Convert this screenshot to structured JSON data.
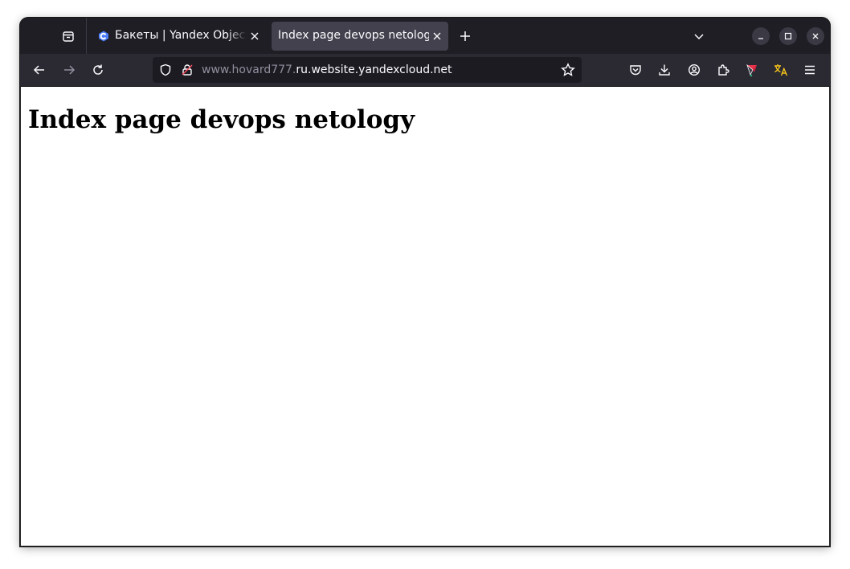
{
  "browser": {
    "tabs": [
      {
        "title": "Бакеты | Yandex Object Storage",
        "active": false,
        "favicon": "yandex-cloud-icon"
      },
      {
        "title": "Index page devops netology",
        "active": true,
        "favicon": ""
      }
    ],
    "url": {
      "prefix": "www.hovard777.",
      "domain": "ru.website.yandexcloud.net"
    },
    "toolbar_icons": [
      "back-arrow-icon",
      "forward-arrow-icon",
      "reload-icon",
      "shield-icon",
      "lock-warning-icon",
      "bookmark-star-icon",
      "pocket-icon",
      "download-icon",
      "account-icon",
      "extensions-icon",
      "extension-colored-icon",
      "translate-icon",
      "menu-icon"
    ],
    "colors": {
      "tabstrip": "#1f1e25",
      "navbar": "#2b2a33",
      "urlbar": "#1c1b22",
      "active_tab": "#42414d",
      "accent_blue": "#4a7cf7",
      "translate_yellow": "#f9c51b"
    }
  },
  "page": {
    "heading": "Index page devops netology"
  }
}
